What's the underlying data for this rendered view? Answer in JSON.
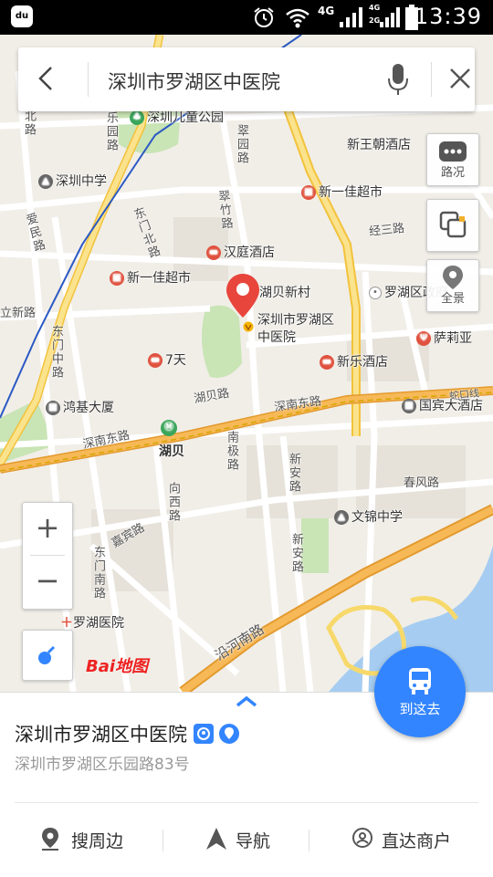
{
  "status_bar": {
    "time": "13:39",
    "network_1": "4G",
    "network_2a": "4G",
    "network_2b": "2G",
    "app_icon_text": "du"
  },
  "search": {
    "query": "深圳市罗湖区中医院"
  },
  "map": {
    "selected_place_label": "深圳市罗湖区中医院",
    "place_labels": {
      "park": "深圳儿童公园",
      "school_n": "深圳中学",
      "hotel_xinwangchao": "新王朝酒店",
      "market_1": "新一佳超市",
      "market_2": "新一佳超市",
      "hotel_hanting": "汉庭酒店",
      "hubei_xincun": "湖贝新村",
      "gov": "罗湖区政府",
      "hotel_7days": "7天",
      "hotel_xinle": "新乐酒店",
      "salia": "萨莉亚",
      "honji": "鸿基大厦",
      "guobin": "国宾大酒店",
      "metro_hubei": "湖贝",
      "school_wenjin": "文锦中学",
      "hospital_luohu": "罗湖医院"
    },
    "road_labels": {
      "shennan_w": "深南东路",
      "shennan_e": "深南东路",
      "hubei": "湖贝路",
      "chunfeng": "春风路",
      "jingsan": "经三路",
      "yanhe": "沿河南路",
      "dongmenzhong": "东门中路",
      "dongmennan": "东门南路",
      "jiabin": "嘉宾路",
      "xinan_1": "新安路",
      "xinan_2": "新安路",
      "nanji": "南极路",
      "xiangxi": "向西路",
      "cuizhu": "翠竹路",
      "cuiyuan": "翠园路",
      "dongmenbei": "东门北路",
      "lebei": "乐园路",
      "aimin": "爱民路",
      "liwen": "立新路",
      "xinbei": "北路",
      "metro_line": "蛇口线"
    },
    "logo_text": "Bai地图"
  },
  "tools": {
    "traffic": "路况",
    "layers": "",
    "panorama": "全景"
  },
  "zoom": {
    "in": "+",
    "out": "−"
  },
  "goto_button": {
    "label": "到这去"
  },
  "panel": {
    "name": "深圳市罗湖区中医院",
    "address": "深圳市罗湖区乐园路83号",
    "actions": {
      "nearby": "搜周边",
      "navigate": "导航",
      "merchant": "直达商户"
    }
  },
  "colors": {
    "accent": "#3385ff",
    "marker": "#e8453c",
    "main_road": "#f7c84a",
    "arterial": "#f2a640",
    "water": "#a6cdf1",
    "green": "#c9e4b5"
  }
}
